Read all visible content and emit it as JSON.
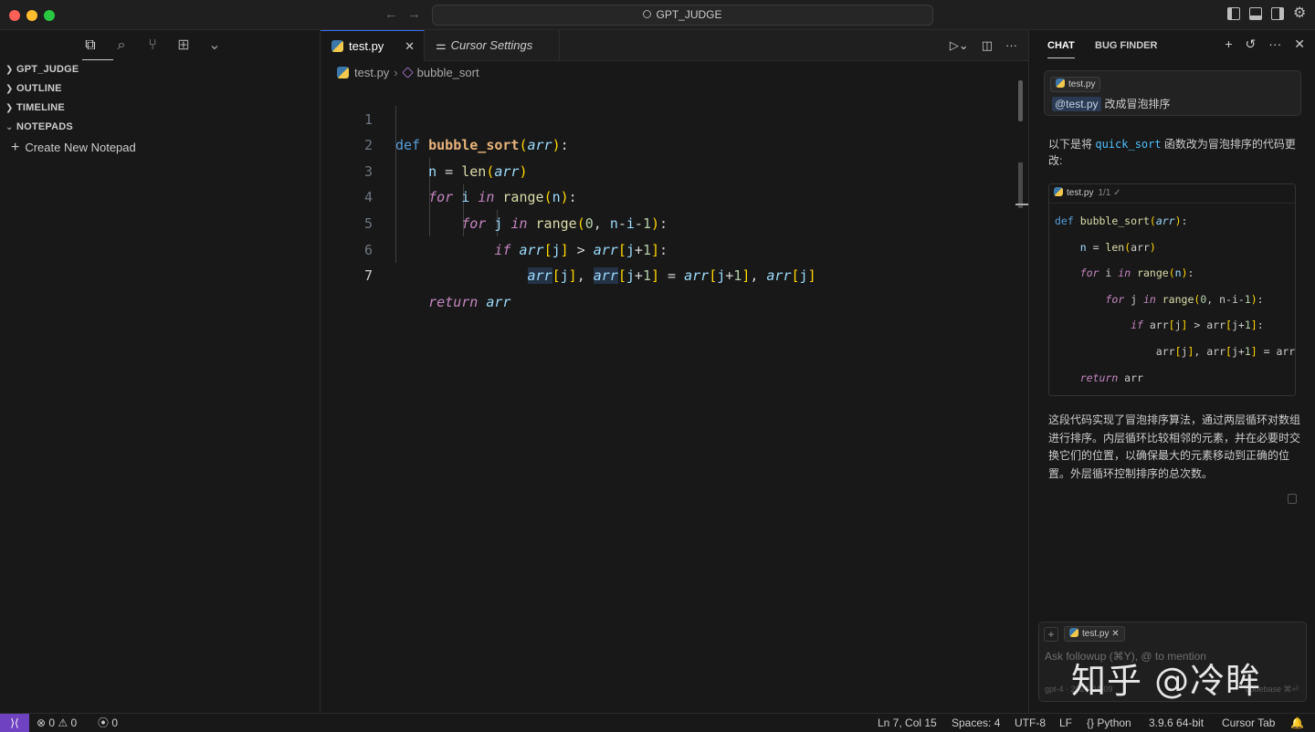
{
  "window": {
    "title": "GPT_JUDGE"
  },
  "sidebar": {
    "sections": [
      {
        "label": "GPT_JUDGE",
        "expanded": false
      },
      {
        "label": "OUTLINE",
        "expanded": false
      },
      {
        "label": "TIMELINE",
        "expanded": false
      },
      {
        "label": "NOTEPADS",
        "expanded": true
      }
    ],
    "create_notepad": "Create New Notepad"
  },
  "editor": {
    "tabs": [
      {
        "label": "test.py",
        "active": true
      },
      {
        "label": "Cursor Settings",
        "active": false
      }
    ],
    "breadcrumb": {
      "file": "test.py",
      "symbol": "bubble_sort"
    },
    "line_numbers": [
      "1",
      "2",
      "3",
      "4",
      "5",
      "6",
      "7"
    ],
    "current_line": 7
  },
  "chat": {
    "tabs": [
      "CHAT",
      "BUG FINDER"
    ],
    "user_message": {
      "chip": "test.py",
      "mention": "@test.py",
      "text": "改成冒泡排序"
    },
    "reply_intro_pre": "以下是将 ",
    "reply_intro_code": "quick_sort",
    "reply_intro_post": " 函数改为冒泡排序的代码更改:",
    "codeblock_header": {
      "file": "test.py",
      "meta": "1/1 ✓"
    },
    "reply_body": "这段代码实现了冒泡排序算法，通过两层循环对数组进行排序。内层循环比较相邻的元素，并在必要时交换它们的位置，以确保最大的元素移动到正确的位置。外层循环控制排序的总次数。",
    "input": {
      "chip": "test.py",
      "placeholder": "Ask followup (⌘Y), @ to mention",
      "footer_left": "gpt-4 · 2024-04-09",
      "footer_right": "codebase ⌘⏎"
    }
  },
  "watermark": "知乎 @冷眸",
  "statusbar": {
    "errors": "0",
    "warnings": "0",
    "ports": "0",
    "position": "Ln 7, Col 15",
    "spaces": "Spaces: 4",
    "encoding": "UTF-8",
    "eol": "LF",
    "language": "Python",
    "interpreter": "3.9.6 64-bit",
    "cursor_tab": "Cursor Tab"
  },
  "colors": {
    "accent": "#3a6df0",
    "remote_badge": "#6f42c1",
    "background": "#181818"
  }
}
